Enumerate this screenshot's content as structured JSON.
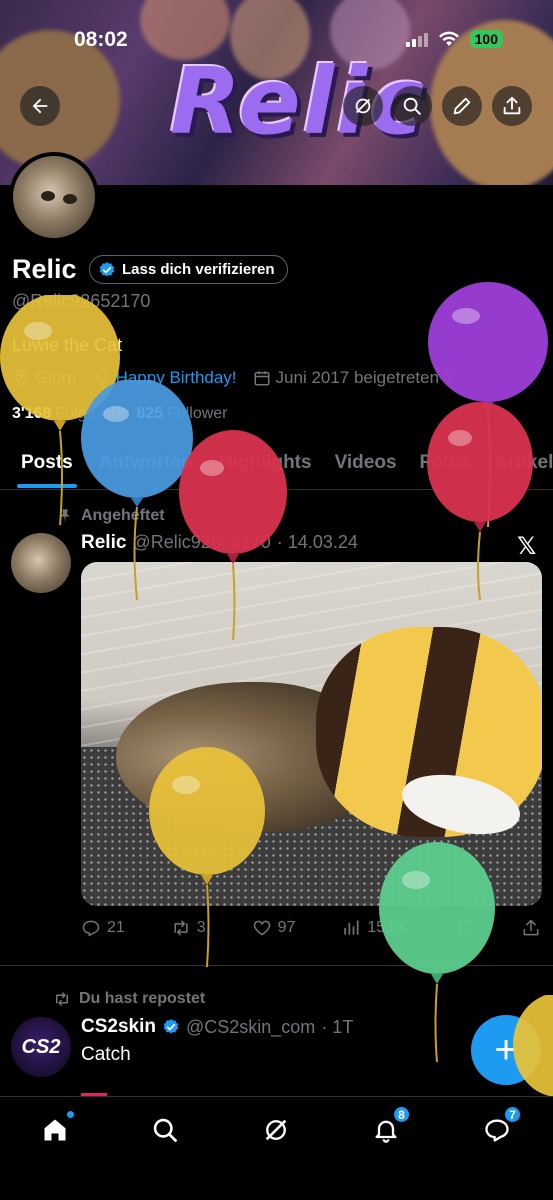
{
  "status": {
    "time": "08:02",
    "battery": "100"
  },
  "banner": {
    "title": "Relic"
  },
  "profile": {
    "name": "Relic",
    "verify_label": "Lass dich verifizieren",
    "handle": "@Relic92652170",
    "bio": "Luwie the Cat",
    "location": "Glorp",
    "birthday": "Happy Birthday!",
    "joined": "Juni 2017 beigetreten",
    "following_count": "3'168",
    "following_label": "Folge ich",
    "followers_count": "825",
    "followers_label": "Follower"
  },
  "tabs": [
    "Posts",
    "Antworten",
    "Highlights",
    "Videos",
    "Fotos",
    "Artikel"
  ],
  "pinned_tweet": {
    "pinned_label": "Angeheftet",
    "author": "Relic",
    "handle": "@Relic92652170",
    "date": "· 14.03.24",
    "replies": "21",
    "retweets": "3",
    "likes": "97",
    "views": "15.8K"
  },
  "repost_tweet": {
    "reposted_label": "Du hast repostet",
    "avatar_text": "CS2",
    "author": "CS2skin",
    "handle": "@CS2skin_com",
    "time": "· 1T",
    "text": "Catch"
  },
  "fab": {
    "label": "+"
  },
  "nav": {
    "notifications_badge": "8",
    "messages_badge": "7"
  },
  "colors": {
    "accent": "#1d9bf0",
    "text_secondary": "#71767b",
    "background": "#000000"
  }
}
